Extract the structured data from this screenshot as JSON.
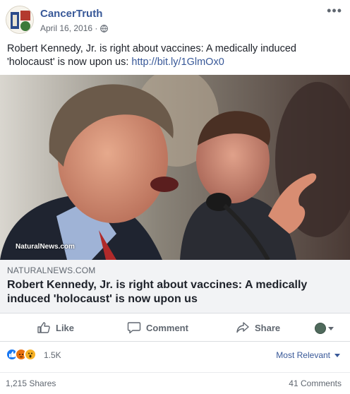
{
  "post": {
    "page_name": "CancerTruth",
    "date": "April 16, 2016 · ",
    "audience_icon": "globe-icon",
    "more_icon": "ellipsis-icon",
    "text_before_link": "Robert Kennedy, Jr. is right about vaccines: A medically induced 'holocaust' is now upon us: ",
    "link_text": "http://bit.ly/1GlmOx0"
  },
  "image": {
    "watermark": "NaturalNews.com"
  },
  "link_preview": {
    "domain": "NATURALNEWS.COM",
    "title": "Robert Kennedy, Jr. is right about vaccines: A medically induced 'holocaust' is now upon us"
  },
  "actions": {
    "like_label": "Like",
    "comment_label": "Comment",
    "share_label": "Share"
  },
  "reactions": {
    "count": "1.5K",
    "types": [
      "like",
      "angry",
      "wow"
    ],
    "sort_label": "Most Relevant"
  },
  "stats": {
    "shares": "1,215 Shares",
    "comments": "41 Comments"
  },
  "colors": {
    "link_blue": "#385898",
    "like_blue": "#1877f2",
    "muted": "#606770"
  }
}
